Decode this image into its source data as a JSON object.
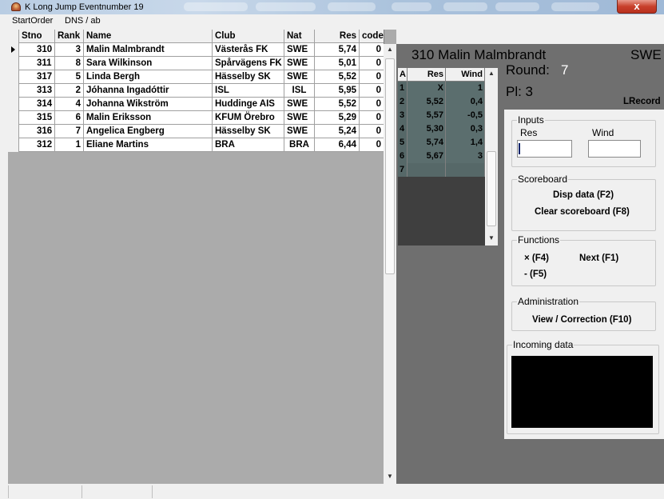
{
  "window": {
    "title": "K Long Jump Eventnumber 19",
    "close_symbol": "x"
  },
  "menu": {
    "items": [
      {
        "label": "StartOrder"
      },
      {
        "label": "DNS / ab"
      }
    ]
  },
  "grid": {
    "headers": {
      "stno": "Stno",
      "rank": "Rank",
      "name": "Name",
      "club": "Club",
      "nat": "Nat",
      "res": "Res",
      "code": "code"
    },
    "rows": [
      {
        "stno": "310",
        "rank": "3",
        "name": "Malin Malmbrandt",
        "club": "Västerås FK",
        "nat": "SWE",
        "res": "5,74",
        "code": "0"
      },
      {
        "stno": "311",
        "rank": "8",
        "name": "Sara Wilkinson",
        "club": "Spårvägens FK",
        "nat": "SWE",
        "res": "5,01",
        "code": "0"
      },
      {
        "stno": "317",
        "rank": "5",
        "name": "Linda Bergh",
        "club": "Hässelby SK",
        "nat": "SWE",
        "res": "5,52",
        "code": "0"
      },
      {
        "stno": "313",
        "rank": "2",
        "name": "Jóhanna Ingadóttir",
        "club": "ISL",
        "nat": "ISL",
        "res": "5,95",
        "code": "0"
      },
      {
        "stno": "314",
        "rank": "4",
        "name": "Johanna Wikström",
        "club": "Huddinge AIS",
        "nat": "SWE",
        "res": "5,52",
        "code": "0"
      },
      {
        "stno": "315",
        "rank": "6",
        "name": "Malin Eriksson",
        "club": "KFUM Örebro",
        "nat": "SWE",
        "res": "5,29",
        "code": "0"
      },
      {
        "stno": "316",
        "rank": "7",
        "name": "Angelica Engberg",
        "club": "Hässelby SK",
        "nat": "SWE",
        "res": "5,24",
        "code": "0"
      },
      {
        "stno": "312",
        "rank": "1",
        "name": "Eliane Martins",
        "club": "BRA",
        "nat": "BRA",
        "res": "6,44",
        "code": "0"
      }
    ]
  },
  "current": {
    "stno_name": "310 Malin Malmbrandt",
    "nat": "SWE",
    "round_label": "Round:",
    "round_value": "7",
    "place": "Pl: 3",
    "record_label": "LRecord"
  },
  "attempts": {
    "headers": {
      "a": "A",
      "res": "Res",
      "wind": "Wind"
    },
    "rows": [
      {
        "a": "1",
        "res": "X",
        "wind": "1"
      },
      {
        "a": "2",
        "res": "5,52",
        "wind": "0,4"
      },
      {
        "a": "3",
        "res": "5,57",
        "wind": "-0,5"
      },
      {
        "a": "4",
        "res": "5,30",
        "wind": "0,3"
      },
      {
        "a": "5",
        "res": "5,74",
        "wind": "1,4"
      },
      {
        "a": "6",
        "res": "5,67",
        "wind": "3"
      },
      {
        "a": "7",
        "res": "",
        "wind": ""
      }
    ]
  },
  "inputs": {
    "group_label": "Inputs",
    "res_label": "Res",
    "wind_label": "Wind",
    "res_value": "",
    "wind_value": ""
  },
  "scoreboard": {
    "group_label": "Scoreboard",
    "disp_data": "Disp data (F2)",
    "clear": "Clear scoreboard (F8)"
  },
  "functions": {
    "group_label": "Functions",
    "x_label": "×  (F4)",
    "next_label": "Next (F1)",
    "dash_label": "-  (F5)"
  },
  "administration": {
    "group_label": "Administration",
    "view_correction": "View / Correction (F10)"
  },
  "incoming": {
    "group_label": "Incoming data"
  }
}
